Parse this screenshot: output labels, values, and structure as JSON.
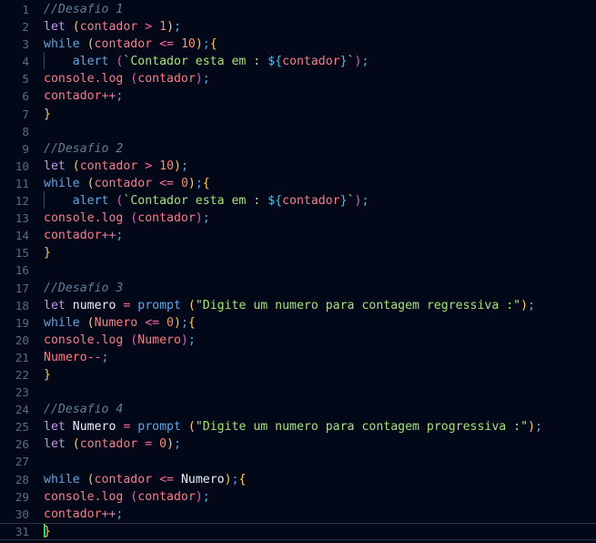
{
  "editor": {
    "language": "javascript",
    "total_lines": 31,
    "active_line": 31,
    "cursor_line": 31,
    "cursor_column": 2,
    "theme": {
      "background": "#030818",
      "line_number": "#5b6a86",
      "active_line_border": "#2b3448",
      "comment": "#5f7e97",
      "keyword_let": "#c792ea",
      "keyword_while": "#5ca7e4",
      "function": "#5ca7e4",
      "variable": "#ff7a85",
      "paren_gold": "#ffca5f",
      "paren_magenta": "#e060b8",
      "operator": "#ff6b9d",
      "number": "#f78c6c",
      "semicolon": "#5ca7e4",
      "string": "#a5e17a",
      "interpolation": "#4fc1e9",
      "caret": "#39d353",
      "indent_guide": "#3a4560"
    }
  },
  "lines": [
    {
      "n": "1",
      "text": "//Desafio 1"
    },
    {
      "n": "2",
      "text": "let (contador > 1);"
    },
    {
      "n": "3",
      "text": "while (contador <= 10);{"
    },
    {
      "n": "4",
      "text": "    alert (`Contador esta em : ${contador}`);"
    },
    {
      "n": "5",
      "text": "console.log (contador);"
    },
    {
      "n": "6",
      "text": "contador++;"
    },
    {
      "n": "7",
      "text": "}"
    },
    {
      "n": "8",
      "text": ""
    },
    {
      "n": "9",
      "text": "//Desafio 2"
    },
    {
      "n": "10",
      "text": "let (contador > 10);"
    },
    {
      "n": "11",
      "text": "while (contador <= 0);{"
    },
    {
      "n": "12",
      "text": "    alert (`Contador esta em : ${contador}`);"
    },
    {
      "n": "13",
      "text": "console.log (contador);"
    },
    {
      "n": "14",
      "text": "contador++;"
    },
    {
      "n": "15",
      "text": "}"
    },
    {
      "n": "16",
      "text": ""
    },
    {
      "n": "17",
      "text": "//Desafio 3"
    },
    {
      "n": "18",
      "text": "let numero = prompt (\"Digite um numero para contagem regressiva :\");"
    },
    {
      "n": "19",
      "text": "while (Numero <= 0);{"
    },
    {
      "n": "20",
      "text": "console.log (Numero);"
    },
    {
      "n": "21",
      "text": "Numero--;"
    },
    {
      "n": "22",
      "text": "}"
    },
    {
      "n": "23",
      "text": ""
    },
    {
      "n": "24",
      "text": "//Desafio 4"
    },
    {
      "n": "25",
      "text": "let Numero = prompt (\"Digite um numero para contagem progressiva :\");"
    },
    {
      "n": "26",
      "text": "let (contador = 0);"
    },
    {
      "n": "27",
      "text": ""
    },
    {
      "n": "28",
      "text": "while (contador <= Numero);{"
    },
    {
      "n": "29",
      "text": "console.log (contador);"
    },
    {
      "n": "30",
      "text": "contador++;"
    },
    {
      "n": "31",
      "text": "}"
    }
  ],
  "tokens": {
    "1": [
      [
        "comment",
        "//Desafio 1"
      ]
    ],
    "2": [
      [
        "keyword",
        "let"
      ],
      [
        "plain",
        " "
      ],
      [
        "paren",
        "("
      ],
      [
        "var",
        "contador"
      ],
      [
        "plain",
        " "
      ],
      [
        "op",
        ">"
      ],
      [
        "plain",
        " "
      ],
      [
        "num",
        "1"
      ],
      [
        "paren",
        ")"
      ],
      [
        "punct",
        ";"
      ]
    ],
    "3": [
      [
        "control",
        "while"
      ],
      [
        "plain",
        " "
      ],
      [
        "paren",
        "("
      ],
      [
        "var",
        "contador"
      ],
      [
        "plain",
        " "
      ],
      [
        "op",
        "<="
      ],
      [
        "plain",
        " "
      ],
      [
        "num",
        "10"
      ],
      [
        "paren",
        ")"
      ],
      [
        "punct",
        ";"
      ],
      [
        "brace",
        "{"
      ]
    ],
    "4": [
      [
        "indent",
        "    "
      ],
      [
        "alert",
        "alert"
      ],
      [
        "plain",
        " "
      ],
      [
        "paren2",
        "("
      ],
      [
        "tick",
        "`"
      ],
      [
        "string",
        "Contador esta em : "
      ],
      [
        "interp",
        "${"
      ],
      [
        "var",
        "contador"
      ],
      [
        "interp",
        "}"
      ],
      [
        "tick",
        "`"
      ],
      [
        "paren2",
        ")"
      ],
      [
        "punct",
        ";"
      ]
    ],
    "5": [
      [
        "var",
        "console"
      ],
      [
        "prop",
        ".log"
      ],
      [
        "plain",
        " "
      ],
      [
        "paren2",
        "("
      ],
      [
        "var",
        "contador"
      ],
      [
        "paren2",
        ")"
      ],
      [
        "punct",
        ";"
      ]
    ],
    "6": [
      [
        "var",
        "contador"
      ],
      [
        "op",
        "++"
      ],
      [
        "punct",
        ";"
      ]
    ],
    "7": [
      [
        "brace",
        "}"
      ]
    ],
    "8": [],
    "9": [
      [
        "comment",
        "//Desafio 2"
      ]
    ],
    "10": [
      [
        "keyword",
        "let"
      ],
      [
        "plain",
        " "
      ],
      [
        "paren",
        "("
      ],
      [
        "var",
        "contador"
      ],
      [
        "plain",
        " "
      ],
      [
        "op",
        ">"
      ],
      [
        "plain",
        " "
      ],
      [
        "num",
        "10"
      ],
      [
        "paren",
        ")"
      ],
      [
        "punct",
        ";"
      ]
    ],
    "11": [
      [
        "control",
        "while"
      ],
      [
        "plain",
        " "
      ],
      [
        "paren",
        "("
      ],
      [
        "var",
        "contador"
      ],
      [
        "plain",
        " "
      ],
      [
        "op",
        "<="
      ],
      [
        "plain",
        " "
      ],
      [
        "num",
        "0"
      ],
      [
        "paren",
        ")"
      ],
      [
        "punct",
        ";"
      ],
      [
        "brace",
        "{"
      ]
    ],
    "12": [
      [
        "indent",
        "    "
      ],
      [
        "alert",
        "alert"
      ],
      [
        "plain",
        " "
      ],
      [
        "paren2",
        "("
      ],
      [
        "tick",
        "`"
      ],
      [
        "string",
        "Contador esta em : "
      ],
      [
        "interp",
        "${"
      ],
      [
        "var",
        "contador"
      ],
      [
        "interp",
        "}"
      ],
      [
        "tick",
        "`"
      ],
      [
        "paren2",
        ")"
      ],
      [
        "punct",
        ";"
      ]
    ],
    "13": [
      [
        "var",
        "console"
      ],
      [
        "prop",
        ".log"
      ],
      [
        "plain",
        " "
      ],
      [
        "paren2",
        "("
      ],
      [
        "var",
        "contador"
      ],
      [
        "paren2",
        ")"
      ],
      [
        "punct",
        ";"
      ]
    ],
    "14": [
      [
        "var",
        "contador"
      ],
      [
        "op",
        "++"
      ],
      [
        "punct",
        ";"
      ]
    ],
    "15": [
      [
        "brace",
        "}"
      ]
    ],
    "16": [],
    "17": [
      [
        "comment",
        "//Desafio 3"
      ]
    ],
    "18": [
      [
        "keyword",
        "let"
      ],
      [
        "plain",
        " "
      ],
      [
        "plain2",
        "numero"
      ],
      [
        "plain",
        " "
      ],
      [
        "op",
        "="
      ],
      [
        "plain",
        " "
      ],
      [
        "func",
        "prompt"
      ],
      [
        "plain",
        " "
      ],
      [
        "paren",
        "("
      ],
      [
        "string",
        "\"Digite um numero para contagem regressiva :\""
      ],
      [
        "paren",
        ")"
      ],
      [
        "punct",
        ";"
      ]
    ],
    "19": [
      [
        "control",
        "while"
      ],
      [
        "plain",
        " "
      ],
      [
        "paren",
        "("
      ],
      [
        "var",
        "Numero"
      ],
      [
        "plain",
        " "
      ],
      [
        "op",
        "<="
      ],
      [
        "plain",
        " "
      ],
      [
        "num",
        "0"
      ],
      [
        "paren",
        ")"
      ],
      [
        "punct",
        ";"
      ],
      [
        "brace",
        "{"
      ]
    ],
    "20": [
      [
        "var",
        "console"
      ],
      [
        "prop",
        ".log"
      ],
      [
        "plain",
        " "
      ],
      [
        "paren2",
        "("
      ],
      [
        "var",
        "Numero"
      ],
      [
        "paren2",
        ")"
      ],
      [
        "punct",
        ";"
      ]
    ],
    "21": [
      [
        "var",
        "Numero"
      ],
      [
        "op",
        "--"
      ],
      [
        "punct",
        ";"
      ]
    ],
    "22": [
      [
        "brace",
        "}"
      ]
    ],
    "23": [],
    "24": [
      [
        "comment",
        "//Desafio 4"
      ]
    ],
    "25": [
      [
        "keyword",
        "let"
      ],
      [
        "plain",
        " "
      ],
      [
        "plain2",
        "Numero"
      ],
      [
        "plain",
        " "
      ],
      [
        "op",
        "="
      ],
      [
        "plain",
        " "
      ],
      [
        "func",
        "prompt"
      ],
      [
        "plain",
        " "
      ],
      [
        "paren",
        "("
      ],
      [
        "string",
        "\"Digite um numero para contagem progressiva :\""
      ],
      [
        "paren",
        ")"
      ],
      [
        "punct",
        ";"
      ]
    ],
    "26": [
      [
        "keyword",
        "let"
      ],
      [
        "plain",
        " "
      ],
      [
        "paren",
        "("
      ],
      [
        "var",
        "contador"
      ],
      [
        "plain",
        " "
      ],
      [
        "op",
        "="
      ],
      [
        "plain",
        " "
      ],
      [
        "num",
        "0"
      ],
      [
        "paren",
        ")"
      ],
      [
        "punct",
        ";"
      ]
    ],
    "27": [],
    "28": [
      [
        "control",
        "while"
      ],
      [
        "plain",
        " "
      ],
      [
        "paren",
        "("
      ],
      [
        "var",
        "contador"
      ],
      [
        "plain",
        " "
      ],
      [
        "op",
        "<="
      ],
      [
        "plain",
        " "
      ],
      [
        "plain2",
        "Numero"
      ],
      [
        "paren",
        ")"
      ],
      [
        "punct",
        ";"
      ],
      [
        "brace",
        "{"
      ]
    ],
    "29": [
      [
        "var",
        "console"
      ],
      [
        "prop",
        ".log"
      ],
      [
        "plain",
        " "
      ],
      [
        "paren2",
        "("
      ],
      [
        "var",
        "contador"
      ],
      [
        "paren2",
        ")"
      ],
      [
        "punct",
        ";"
      ]
    ],
    "30": [
      [
        "var",
        "contador"
      ],
      [
        "op",
        "++"
      ],
      [
        "punct",
        ";"
      ]
    ],
    "31": [
      [
        "caret",
        ""
      ],
      [
        "brace",
        "}"
      ]
    ]
  }
}
